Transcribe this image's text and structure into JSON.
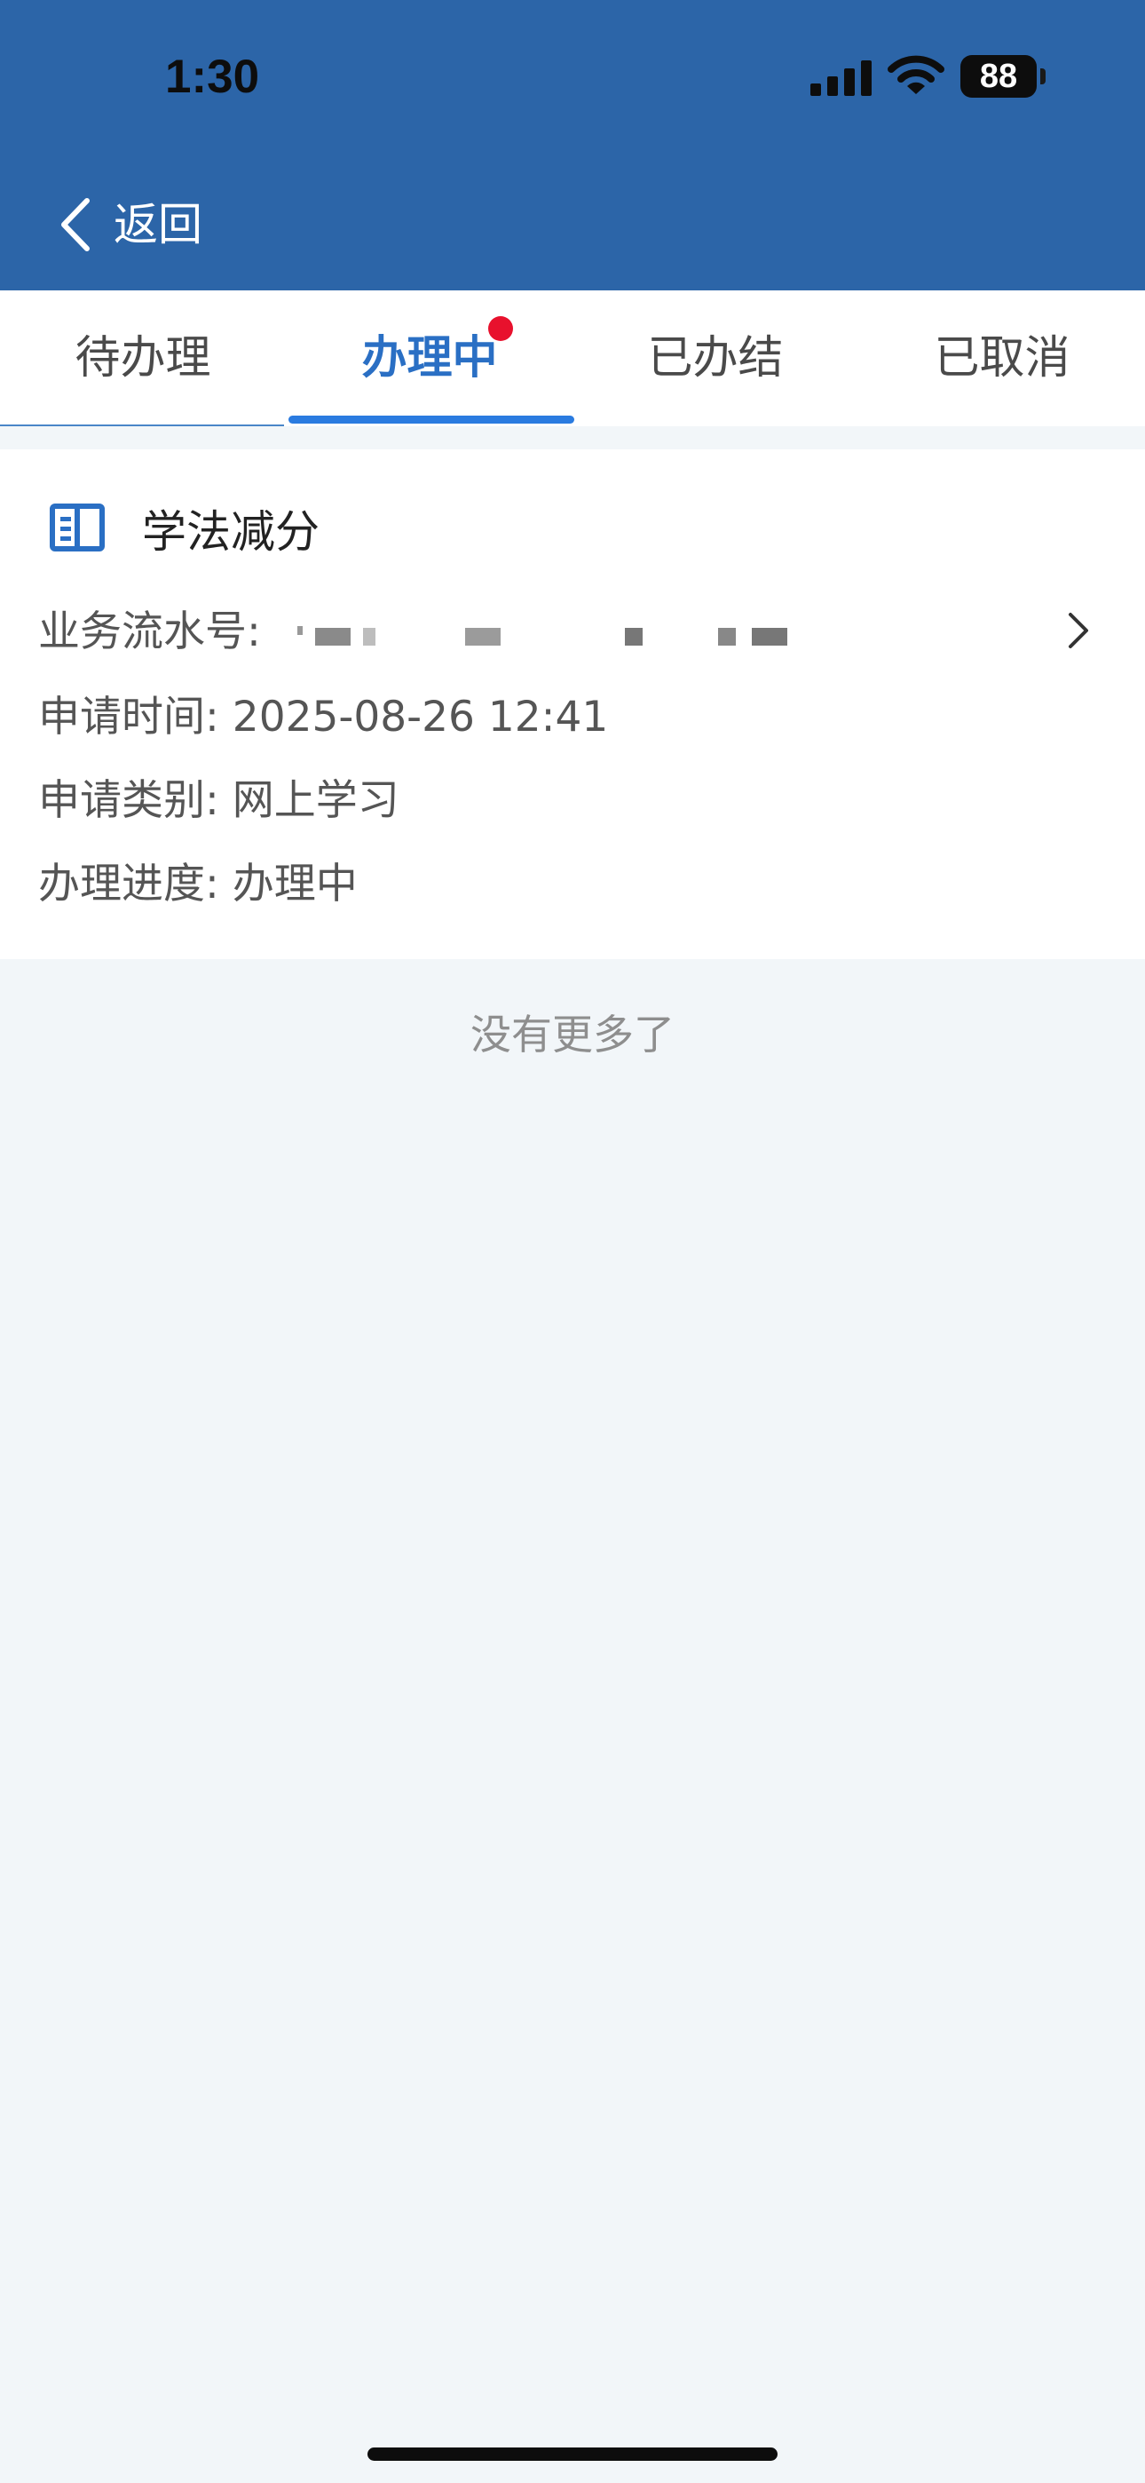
{
  "status_bar": {
    "time": "1:30",
    "battery": "88"
  },
  "nav": {
    "back_label": "返回",
    "title": ""
  },
  "tabs": [
    {
      "label": "待办理"
    },
    {
      "label": "办理中"
    },
    {
      "label": "已办结"
    },
    {
      "label": "已取消"
    }
  ],
  "card": {
    "title": "学法减分",
    "icon": "book-icon",
    "fields": [
      {
        "label": "业务流水号:",
        "value": ""
      },
      {
        "label": "申请时间:",
        "value": "2025-08-26 12:41"
      },
      {
        "label": "申请类别:",
        "value": "网上学习"
      },
      {
        "label": "办理进度:",
        "value": "办理中"
      }
    ]
  },
  "footer": {
    "text": "没有更多了"
  },
  "colors": {
    "header": "#2c65a8",
    "accent": "#2a7be0",
    "badge": "#e8112d",
    "page_bg": "#f2f6f9"
  }
}
